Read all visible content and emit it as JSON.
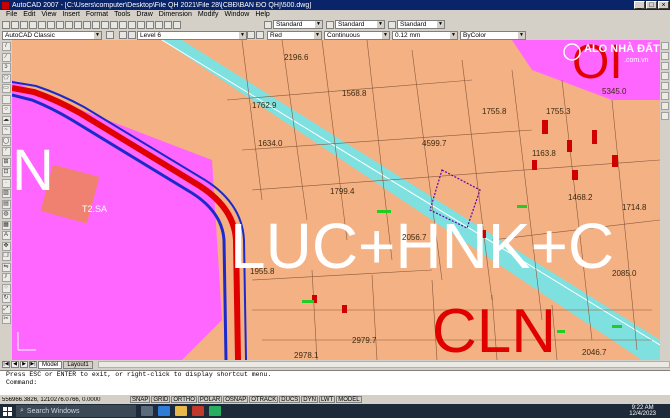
{
  "window": {
    "title": "AutoCAD 2007 - [C:\\Users\\computer\\Desktop\\File QH 2021\\File 28\\[CBĐ\\BẢN ĐỒ QH]\\500.dwg]",
    "minimize": "_",
    "maximize": "□",
    "close": "×"
  },
  "menu": [
    "File",
    "Edit",
    "View",
    "Insert",
    "Format",
    "Tools",
    "Draw",
    "Dimension",
    "Modify",
    "Window",
    "Help"
  ],
  "toolbar": {
    "text_style": "Standard",
    "dim_style": "Standard",
    "table_style": "Standard",
    "workspace": "AutoCAD Classic",
    "layer": "Level 6",
    "color": "Red",
    "linetype": "Continuous",
    "lineweight": "0.12 mm",
    "plotstyle": "ByColor"
  },
  "drawing": {
    "big_labels": {
      "zone1": "LUC+HNK+C",
      "zone2": "CLN",
      "zone3": "OI",
      "zone4": "N"
    },
    "parcel_areas": [
      "2196.6",
      "1762.9",
      "1634.0",
      "1568.8",
      "4599.7",
      "1799.4",
      "2056.7",
      "1955.8",
      "2979.7",
      "2978.1",
      "1755.3",
      "2046.7",
      "1714.8",
      "1163.8",
      "1468.2",
      "1755.8",
      "2085.0",
      "5345.0"
    ],
    "misc_labels": [
      "T2.SA"
    ],
    "watermark": {
      "line1": "ALO NHÀ ĐẤT",
      "line2": ".com.vn"
    }
  },
  "tabs": {
    "model": "Model",
    "layout1": "Layout1"
  },
  "command": {
    "line1": "Press ESC or ENTER to exit, or right-click to display shortcut menu.",
    "prompt": "Command:"
  },
  "status": {
    "coords": "556966.3826, 1210276.0766, 0.0000",
    "buttons": [
      "SNAP",
      "GRID",
      "ORTHO",
      "POLAR",
      "OSNAP",
      "OTRACK",
      "DUCS",
      "DYN",
      "LWT",
      "MODEL"
    ]
  },
  "taskbar": {
    "search_placeholder": "Search Windows",
    "time": "9:22 AM",
    "date": "12/4/2023"
  },
  "colors": {
    "land_orange": "#f4b183",
    "zone_pink": "#ff66ff",
    "road_cyan": "#7fe0e0",
    "boundary_red": "#e00000",
    "boundary_blue": "#1a2acc"
  }
}
